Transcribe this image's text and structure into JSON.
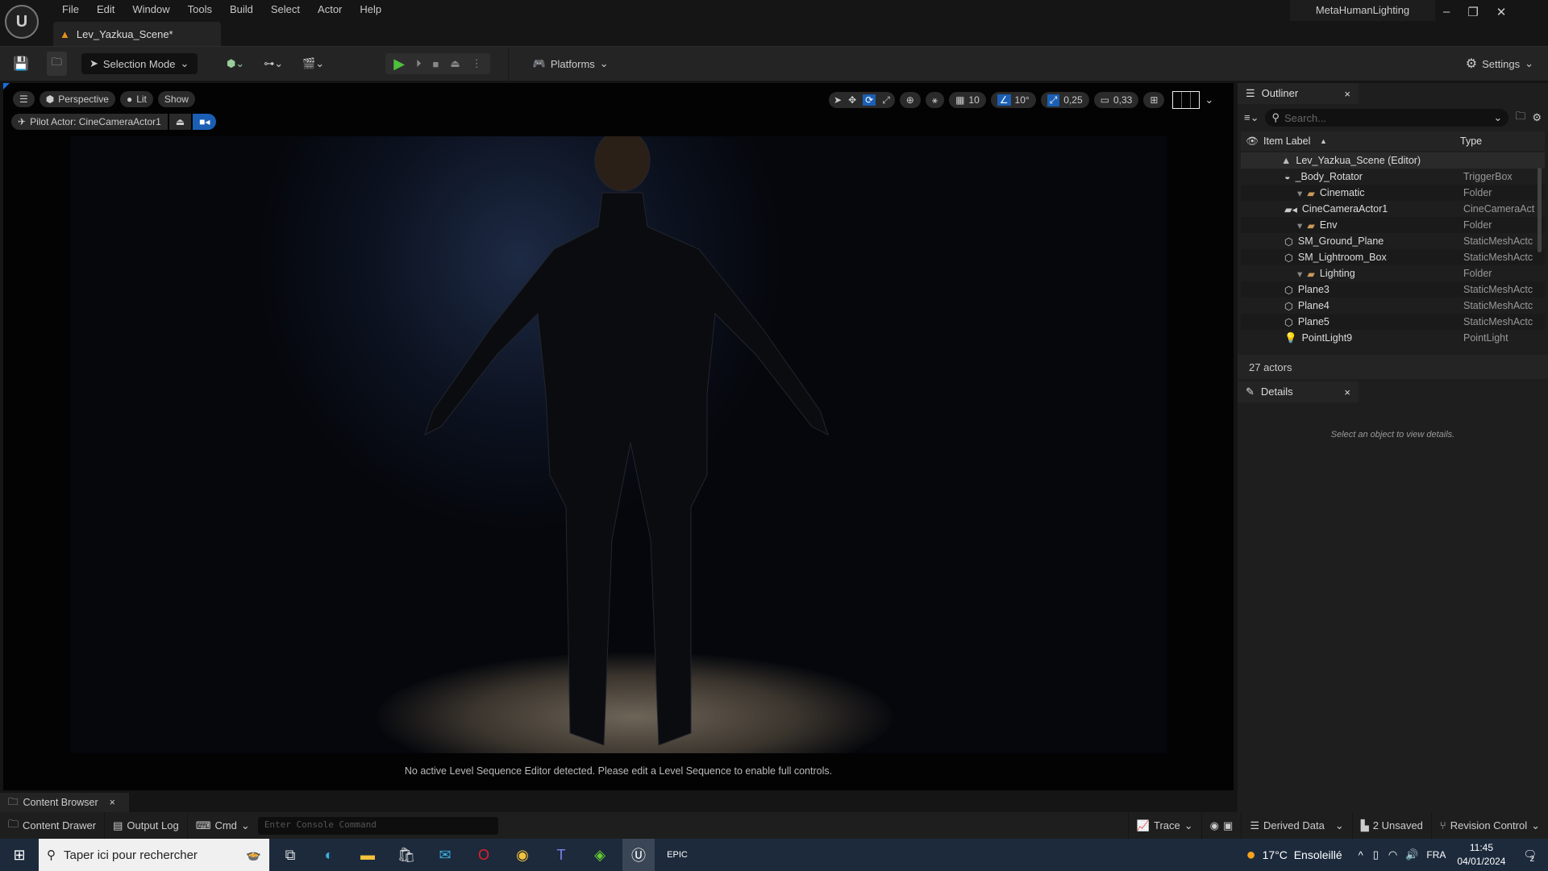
{
  "app": {
    "logo": "U",
    "menu": [
      "File",
      "Edit",
      "Window",
      "Tools",
      "Build",
      "Select",
      "Actor",
      "Help"
    ],
    "document_tab": "Lev_Yazkua_Scene*",
    "project_name": "MetaHumanLighting",
    "window_controls": [
      "–",
      "❐",
      "✕"
    ]
  },
  "toolbar": {
    "selection_mode": "Selection Mode",
    "platforms": "Platforms",
    "settings": "Settings"
  },
  "viewport": {
    "menu": "☰",
    "perspective": "Perspective",
    "lit": "Lit",
    "show": "Show",
    "pilot_actor": "Pilot Actor: CineCameraActor1",
    "grid_snap": "10",
    "rotation_snap": "10°",
    "scale_snap": "0,25",
    "camera_speed": "0,33",
    "message": "No active Level Sequence Editor detected. Please edit a Level Sequence to enable full controls."
  },
  "outliner": {
    "tab": "Outliner",
    "search_placeholder": "Search...",
    "col_label": "Item Label",
    "col_type": "Type",
    "sort_icon": "▲",
    "rows": [
      {
        "label": "Lev_Yazkua_Scene (Editor)",
        "type": "",
        "icon": "level",
        "indent": 0
      },
      {
        "label": "_Body_Rotator",
        "type": "TriggerBox",
        "icon": "trigger",
        "indent": 2
      },
      {
        "label": "Cinematic",
        "type": "Folder",
        "icon": "folder",
        "indent": 1
      },
      {
        "label": "CineCameraActor1",
        "type": "CineCameraAct",
        "icon": "camera",
        "indent": 2
      },
      {
        "label": "Env",
        "type": "Folder",
        "icon": "folder",
        "indent": 1
      },
      {
        "label": "SM_Ground_Plane",
        "type": "StaticMeshActc",
        "icon": "mesh",
        "indent": 2
      },
      {
        "label": "SM_Lightroom_Box",
        "type": "StaticMeshActc",
        "icon": "mesh",
        "indent": 2
      },
      {
        "label": "Lighting",
        "type": "Folder",
        "icon": "folder",
        "indent": 1
      },
      {
        "label": "Plane3",
        "type": "StaticMeshActc",
        "icon": "mesh",
        "indent": 2
      },
      {
        "label": "Plane4",
        "type": "StaticMeshActc",
        "icon": "mesh",
        "indent": 2
      },
      {
        "label": "Plane5",
        "type": "StaticMeshActc",
        "icon": "mesh",
        "indent": 2
      },
      {
        "label": "PointLight9",
        "type": "PointLight",
        "icon": "light",
        "indent": 2
      }
    ],
    "count": "27 actors"
  },
  "details": {
    "tab": "Details",
    "empty": "Select an object to view details."
  },
  "bottom": {
    "content_browser_tab": "Content Browser",
    "content_drawer": "Content Drawer",
    "output_log": "Output Log",
    "cmd": "Cmd",
    "console_placeholder": "Enter Console Command",
    "trace": "Trace",
    "derived_data": "Derived Data",
    "unsaved": "2 Unsaved",
    "revision_control": "Revision Control"
  },
  "taskbar": {
    "search_placeholder": "Taper ici pour rechercher",
    "weather": "17°C  Ensoleillé",
    "language": "FRA",
    "time": "11:45",
    "date": "04/01/2024",
    "notifications": "2"
  }
}
